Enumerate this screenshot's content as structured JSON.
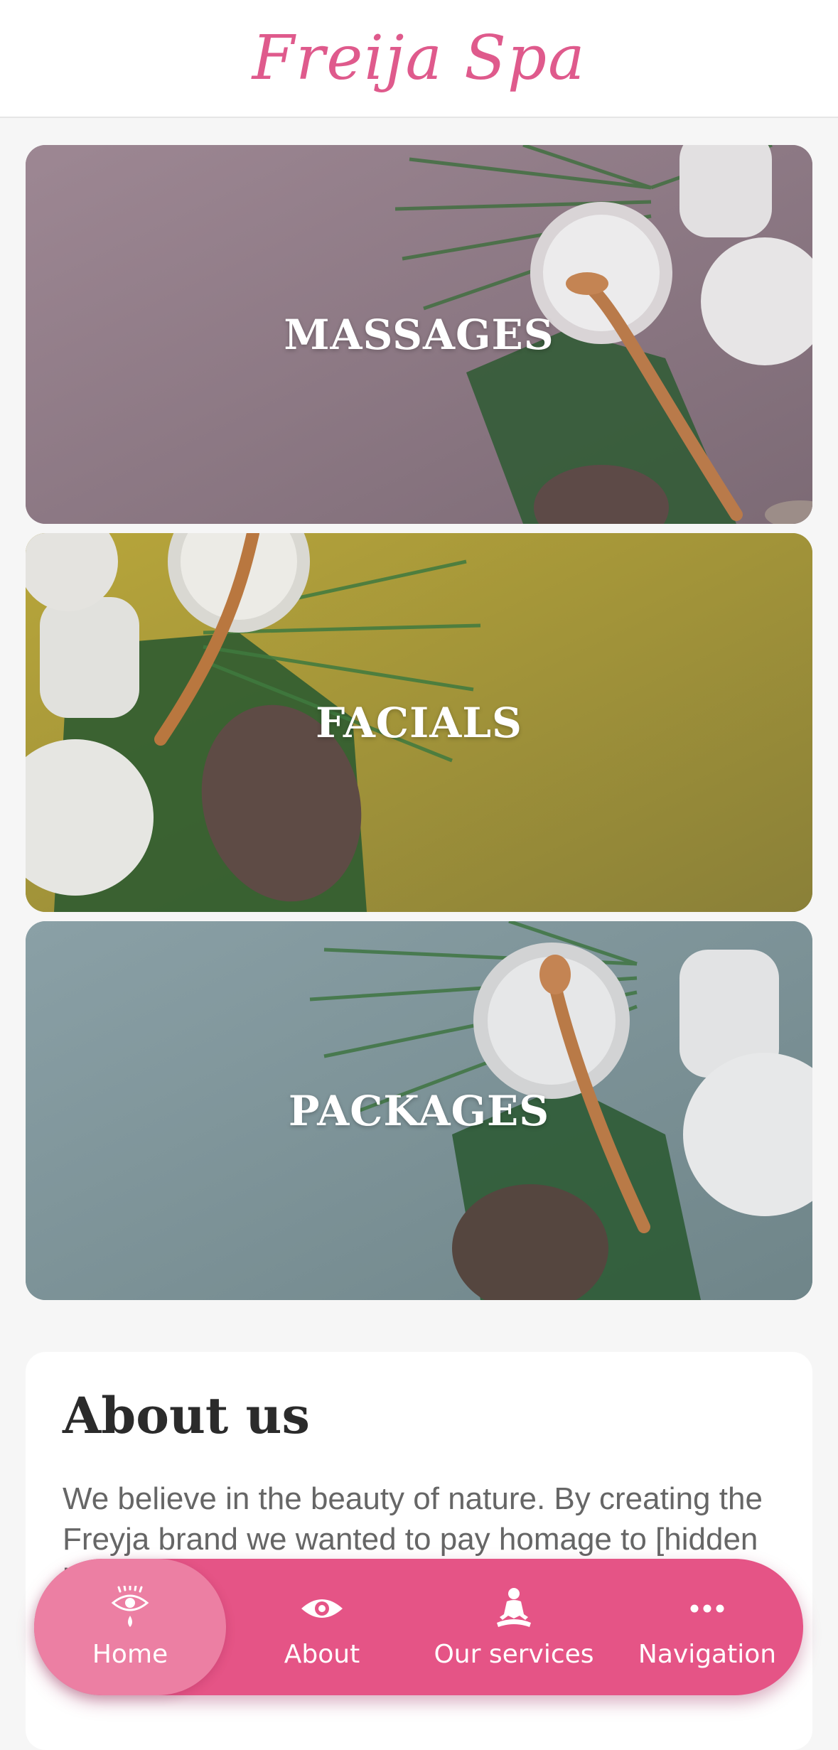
{
  "header": {
    "brand": "Freija Spa"
  },
  "categories": [
    {
      "label": "MASSAGES"
    },
    {
      "label": "FACIALS"
    },
    {
      "label": "PACKAGES"
    }
  ],
  "about": {
    "title": "About us",
    "text": "We believe in the beauty of nature. By creating the Freyja brand we wanted to pay homage to [hidden behind navigation bar] designed to give you the best of what nature"
  },
  "nav": {
    "items": [
      {
        "label": "Home",
        "icon": "eye-drop-icon",
        "active": true
      },
      {
        "label": "About",
        "icon": "eye-icon",
        "active": false
      },
      {
        "label": "Our services",
        "icon": "meditation-icon",
        "active": false
      },
      {
        "label": "Navigation",
        "icon": "more-dots-icon",
        "active": false
      }
    ]
  },
  "colors": {
    "accent": "#e55486",
    "accent_active": "#ec7fa3",
    "brand": "#df5a8c"
  }
}
